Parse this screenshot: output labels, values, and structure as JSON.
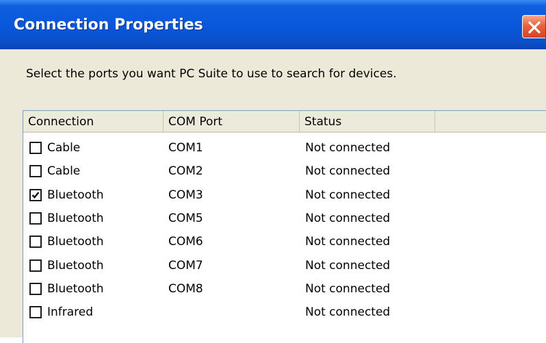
{
  "window": {
    "title": "Connection Properties",
    "close_icon": "close-icon"
  },
  "instruction": "Select the ports you want PC Suite to use to search for devices.",
  "list": {
    "columns": [
      "Connection",
      "COM Port",
      "Status",
      ""
    ],
    "rows": [
      {
        "checked": false,
        "connection": "Cable",
        "port": "COM1",
        "status": "Not connected"
      },
      {
        "checked": false,
        "connection": "Cable",
        "port": "COM2",
        "status": "Not connected"
      },
      {
        "checked": true,
        "connection": "Bluetooth",
        "port": "COM3",
        "status": "Not connected"
      },
      {
        "checked": false,
        "connection": "Bluetooth",
        "port": "COM5",
        "status": "Not connected"
      },
      {
        "checked": false,
        "connection": "Bluetooth",
        "port": "COM6",
        "status": "Not connected"
      },
      {
        "checked": false,
        "connection": "Bluetooth",
        "port": "COM7",
        "status": "Not connected"
      },
      {
        "checked": false,
        "connection": "Bluetooth",
        "port": "COM8",
        "status": "Not connected"
      },
      {
        "checked": false,
        "connection": "Infrared",
        "port": "",
        "status": "Not connected"
      }
    ]
  },
  "colors": {
    "titlebar": "#0857db",
    "client": "#ece9d8",
    "close_button": "#e8633f"
  }
}
